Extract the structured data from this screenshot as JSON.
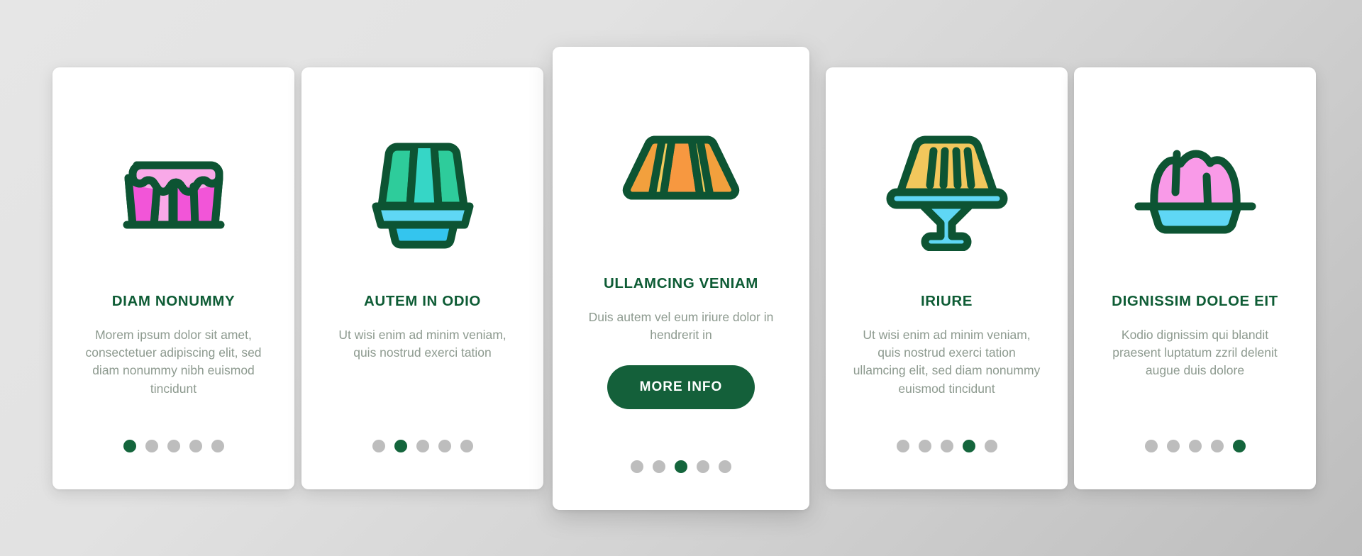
{
  "theme": {
    "brand_green": "#14603a",
    "title_green": "#0e5c35",
    "body_gray": "#8d9a8f",
    "dot_inactive": "#bdbdbd",
    "dot_active": "#14653c",
    "card_bg": "#ffffff",
    "page_bg_light": "#e6e6e6",
    "page_bg_dark": "#bdbdbd"
  },
  "cards": [
    {
      "id": "card-1",
      "icon": "jelly-dripping-pink-icon",
      "title": "DIAM NONUMMY",
      "body": "Morem ipsum dolor sit amet, consectetuer adipiscing elit, sed diam nonummy nibh euismod tincidunt",
      "featured": false,
      "cta": null,
      "dots": {
        "count": 5,
        "active_index": 0
      }
    },
    {
      "id": "card-2",
      "icon": "jelly-green-on-blue-plate-icon",
      "title": "AUTEM IN ODIO",
      "body": "Ut wisi enim ad minim veniam, quis nostrud exerci tation",
      "featured": false,
      "cta": null,
      "dots": {
        "count": 5,
        "active_index": 1
      }
    },
    {
      "id": "card-3",
      "icon": "jelly-orange-trapezoid-icon",
      "title": "ULLAMCING VENIAM",
      "body": "Duis autem vel eum iriure dolor in hendrerit in",
      "featured": true,
      "cta": "MORE INFO",
      "dots": {
        "count": 5,
        "active_index": 2
      }
    },
    {
      "id": "card-4",
      "icon": "pudding-yellow-on-stand-icon",
      "title": "IRIURE",
      "body": "Ut wisi enim ad minim veniam, quis nostrud exerci tation ullamcing elit, sed diam nonummy euismod tincidunt",
      "featured": false,
      "cta": null,
      "dots": {
        "count": 5,
        "active_index": 3
      }
    },
    {
      "id": "card-5",
      "icon": "pudding-pink-on-tray-icon",
      "title": "DIGNISSIM DOLOE EIT",
      "body": "Kodio dignissim qui blandit praesent luptatum zzril delenit augue duis dolore",
      "featured": false,
      "cta": null,
      "dots": {
        "count": 5,
        "active_index": 4
      }
    }
  ]
}
